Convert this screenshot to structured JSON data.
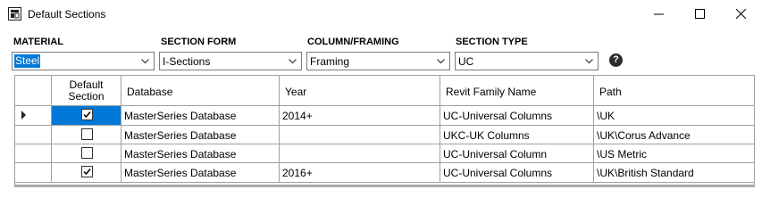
{
  "window": {
    "title": "Default Sections"
  },
  "filters": [
    {
      "label": "MATERIAL",
      "value": "Steel",
      "selected": true
    },
    {
      "label": "SECTION FORM",
      "value": "I-Sections",
      "selected": false
    },
    {
      "label": "COLUMN/FRAMING",
      "value": "Framing",
      "selected": false
    },
    {
      "label": "SECTION TYPE",
      "value": "UC",
      "selected": false
    }
  ],
  "help_glyph": "?",
  "table": {
    "columns": [
      "Default Section",
      "Database",
      "Year",
      "Revit Family Name",
      "Path"
    ],
    "rows": [
      {
        "checked": true,
        "database": "MasterSeries Database",
        "year": "2014+",
        "family": "UC-Universal Columns",
        "path": "\\UK",
        "current": true
      },
      {
        "checked": false,
        "database": "MasterSeries Database",
        "year": "",
        "family": "UKC-UK Columns",
        "path": "\\UK\\Corus Advance",
        "current": false
      },
      {
        "checked": false,
        "database": "MasterSeries Database",
        "year": "",
        "family": "UC-Universal Column",
        "path": "\\US Metric",
        "current": false
      },
      {
        "checked": true,
        "database": "MasterSeries Database",
        "year": "2016+",
        "family": "UC-Universal Columns",
        "path": "\\UK\\British Standard",
        "current": false
      }
    ]
  },
  "colors": {
    "selection": "#0078d7",
    "grid_line": "#a0a0a0"
  }
}
